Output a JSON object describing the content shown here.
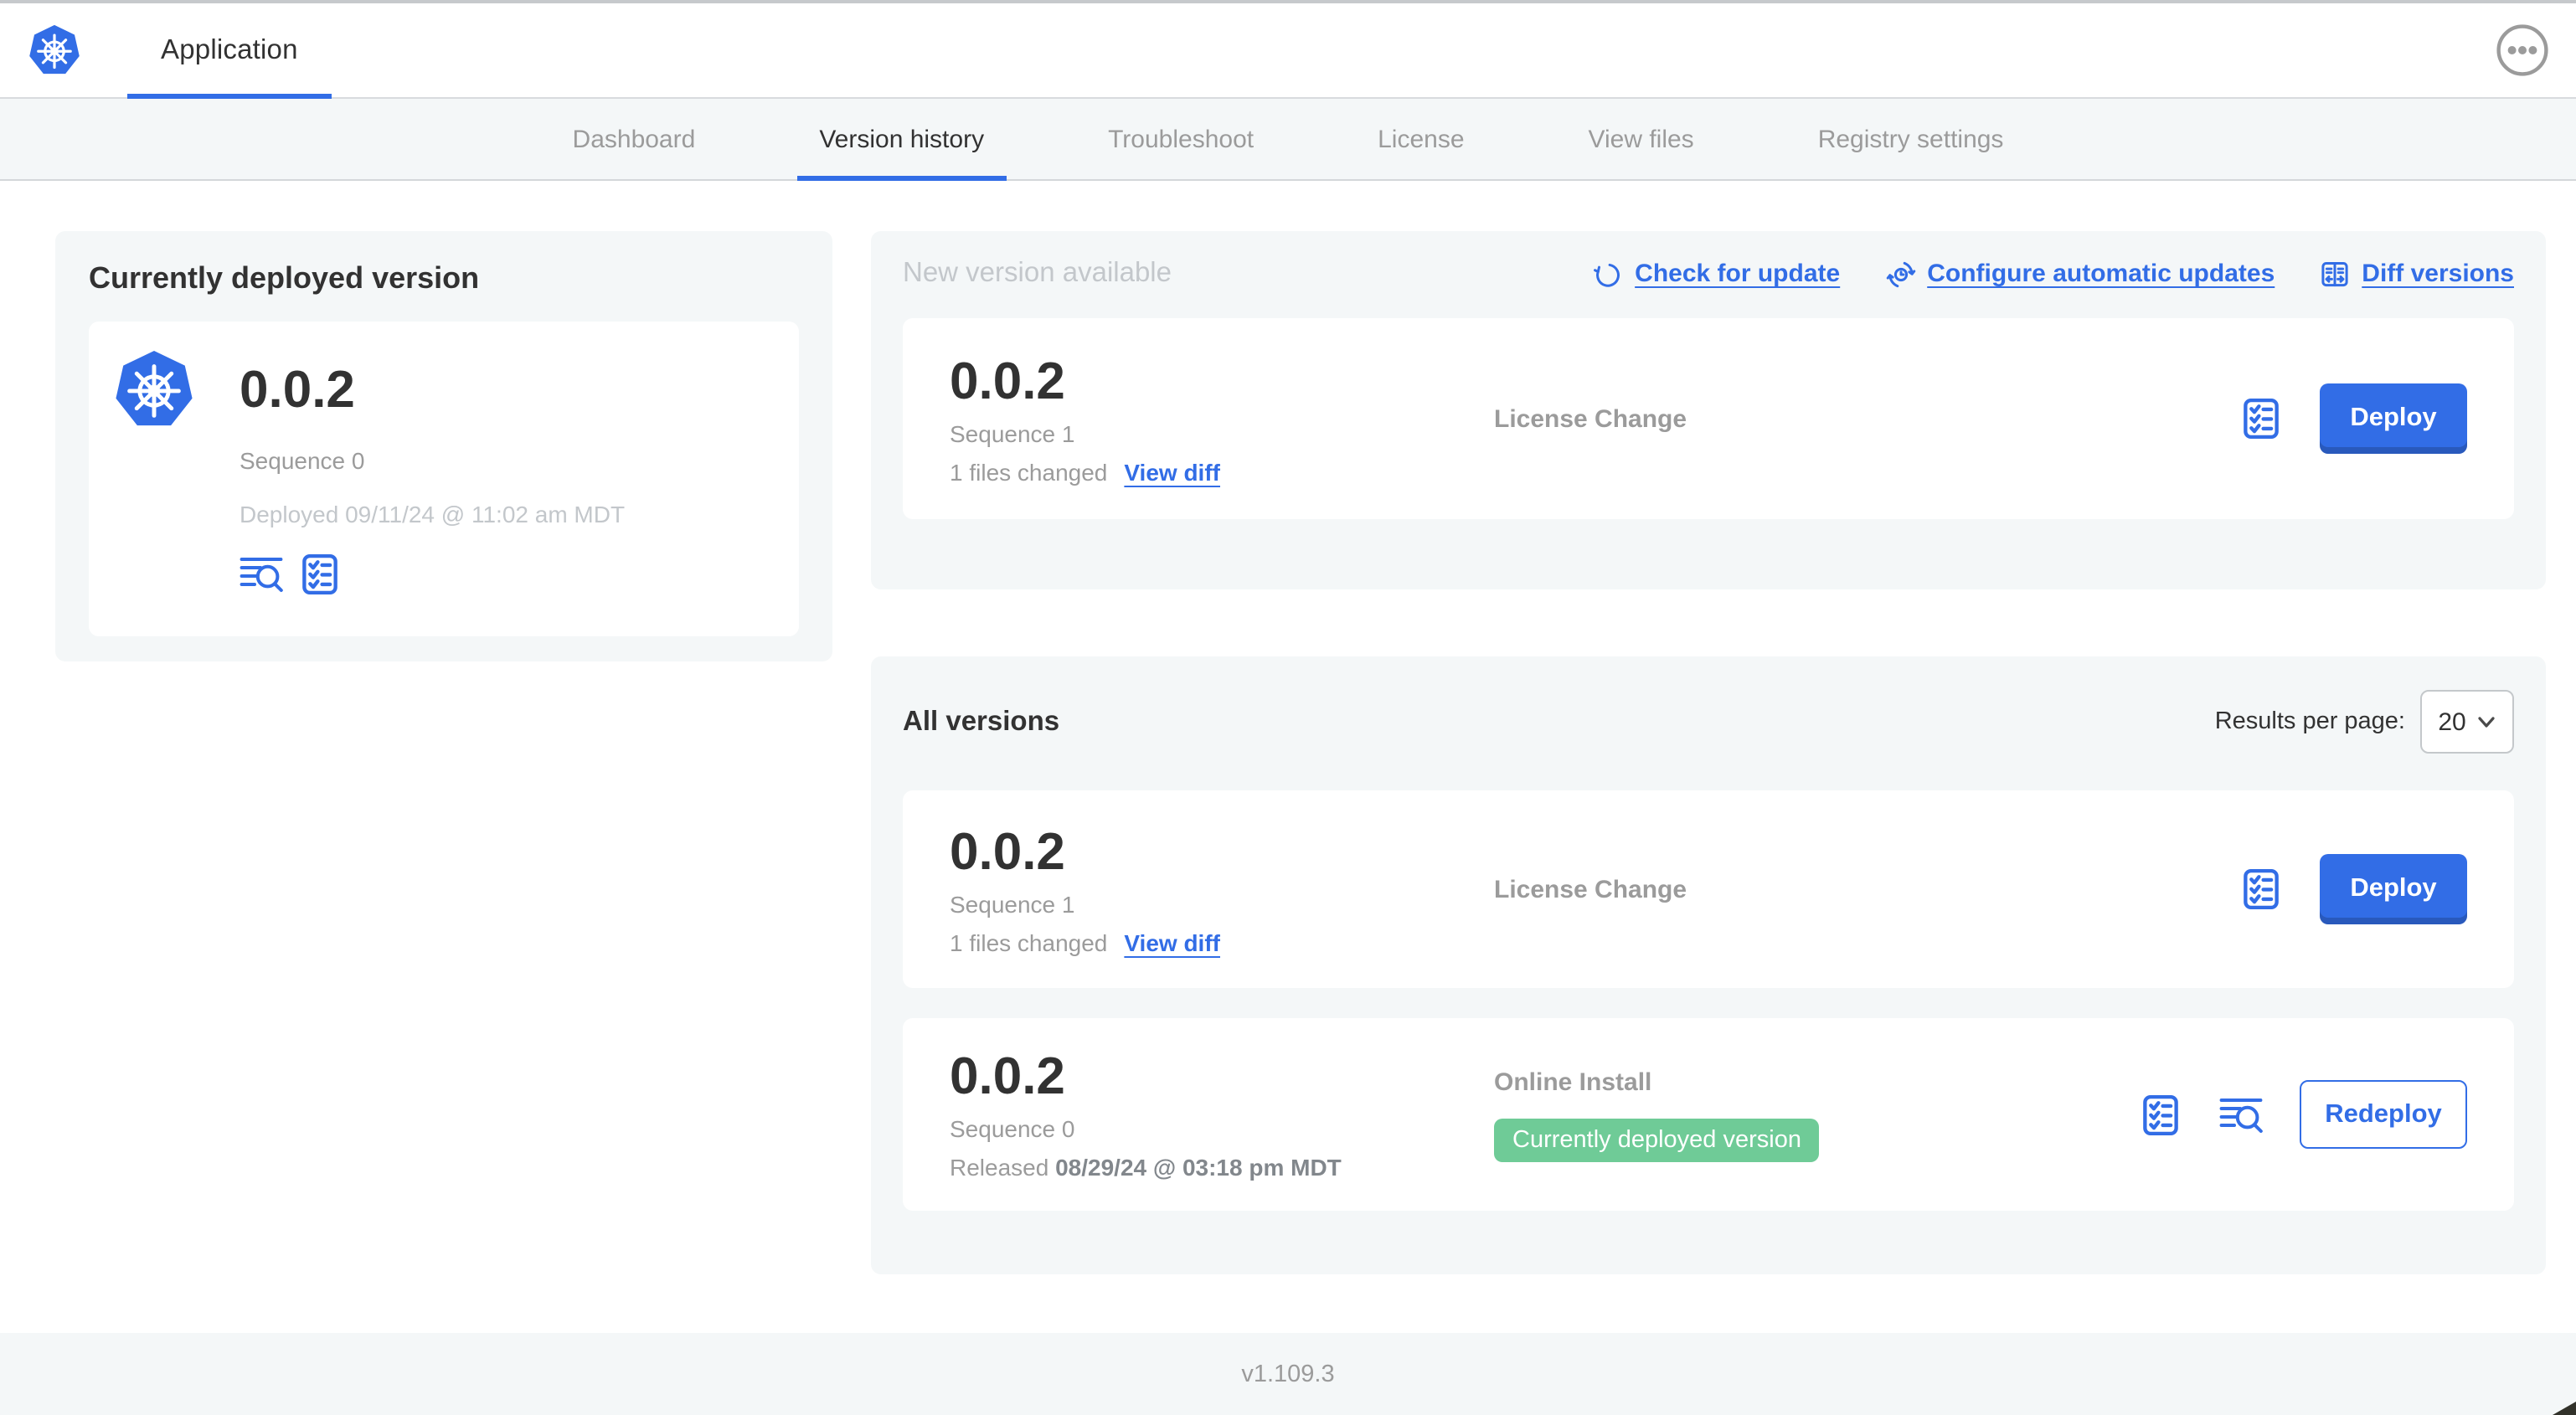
{
  "header": {
    "app_title": "Application"
  },
  "nav": {
    "tabs": [
      {
        "label": "Dashboard",
        "active": false
      },
      {
        "label": "Version history",
        "active": true
      },
      {
        "label": "Troubleshoot",
        "active": false
      },
      {
        "label": "License",
        "active": false
      },
      {
        "label": "View files",
        "active": false
      },
      {
        "label": "Registry settings",
        "active": false
      }
    ]
  },
  "current_version": {
    "section_title": "Currently deployed version",
    "version": "0.0.2",
    "sequence": "Sequence 0",
    "deployed": "Deployed 09/11/24 @ 11:02 am MDT"
  },
  "new_version": {
    "section_title": "New version available",
    "check_for_update": "Check for update",
    "configure_updates": "Configure automatic updates",
    "diff_versions": "Diff versions",
    "row": {
      "version": "0.0.2",
      "sequence": "Sequence 1",
      "files_changed": "1 files changed",
      "view_diff": "View diff",
      "source": "License Change",
      "action": "Deploy"
    }
  },
  "all_versions": {
    "section_title": "All versions",
    "results_per_page_label": "Results per page:",
    "results_per_page": "20",
    "rows": [
      {
        "version": "0.0.2",
        "sequence": "Sequence 1",
        "files_changed": "1 files changed",
        "view_diff": "View diff",
        "source": "License Change",
        "action": "Deploy"
      },
      {
        "version": "0.0.2",
        "sequence": "Sequence 0",
        "released_label": "Released",
        "released_date": "08/29/24 @ 03:18 pm MDT",
        "source": "Online Install",
        "badge": "Currently deployed version",
        "action": "Redeploy"
      }
    ]
  },
  "footer": {
    "app_version": "v1.109.3"
  },
  "icons": {
    "app_logo": "kubernetes-wheel",
    "more_menu": "ellipsis-circle",
    "check_for_update": "rotate-ccw",
    "configure_updates": "clock-sync-arrows",
    "diff_versions": "split-diff",
    "preflight": "checklist",
    "logs": "log-search",
    "select_chevron": "chevron-down"
  },
  "colors": {
    "primary_blue": "#326de6",
    "badge_green": "#6fcb97",
    "text_dark": "#323232",
    "text_gray": "#9b9b9b",
    "text_light_gray": "#c3c7cb",
    "section_bg": "#f4f7f8"
  }
}
